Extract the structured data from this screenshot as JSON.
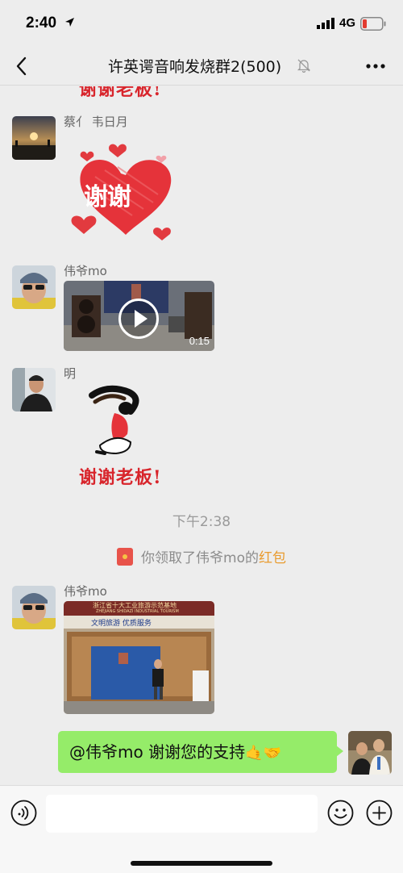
{
  "status_bar": {
    "time": "2:40",
    "network": "4G"
  },
  "nav": {
    "title": "许英谔音响发烧群2(500)"
  },
  "messages": {
    "top_partial_sticker_text": "谢谢老板!",
    "m1": {
      "sender": "蔡亻 韦日月",
      "sticker_text": "谢谢"
    },
    "m2": {
      "sender": "伟爷mo",
      "video_duration": "0:15"
    },
    "m3": {
      "sender": "明",
      "sticker_text": "谢谢老板!"
    },
    "time_divider": "下午2:38",
    "system": {
      "prefix": "你领取了伟爷mo的",
      "link": "红包"
    },
    "m4": {
      "sender": "伟爷mo",
      "photo_banner": "浙江省十大工业旅游示范基地",
      "photo_banner_en": "ZHEJIANG SHIDAZI INDUSTRIAL TOURISM",
      "photo_sign": "文明旅游  优质服务"
    },
    "m5": {
      "text": "@伟爷mo 谢谢您的支持",
      "emoji": "🤙🤝"
    }
  },
  "colors": {
    "outgoing_bubble": "#95ec69",
    "sticker_red": "#d8252c",
    "link_orange": "#e99b2e",
    "background": "#ededed"
  },
  "icons": {
    "back": "chevron-left-icon",
    "mute": "bell-off-icon",
    "more": "more-dots-icon",
    "voice": "voice-icon",
    "emoji": "emoji-icon",
    "plus": "plus-icon"
  }
}
